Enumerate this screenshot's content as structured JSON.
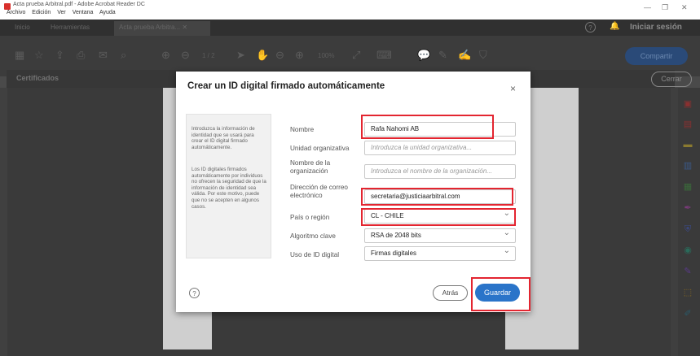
{
  "window": {
    "title": "Acta prueba Arbitral.pdf - Adobe Acrobat Reader DC",
    "menu": [
      "Archivo",
      "Edición",
      "Ver",
      "Ventana",
      "Ayuda"
    ],
    "minimize": "—",
    "restore": "❐",
    "close": "✕"
  },
  "nav": {
    "tabs": [
      "Inicio",
      "Herramientas"
    ],
    "doc_tab": "Acta prueba Arbitra... ✕",
    "sign_in": "Iniciar sesión",
    "help": "?",
    "bell": "🔔"
  },
  "toolbar": {
    "zoom": "100%",
    "page": "1 / 2",
    "share": "Compartir"
  },
  "certificates_bar": {
    "label": "Certificados",
    "close": "Cerrar"
  },
  "dialog": {
    "title": "Crear un ID digital firmado automáticamente",
    "close": "×",
    "info_p1": "Introduzca la información de identidad que se usará para crear el ID digital firmado automáticamente.",
    "info_p2": "Los ID digitales firmados automáticamente por individuos no ofrecen la seguridad de que la información de identidad sea válida. Por este motivo, puede que no se acepten en algunos casos.",
    "fields": {
      "name_label": "Nombre",
      "name_value": "Rafa Nahomi AB",
      "org_unit_label": "Unidad organizativa",
      "org_unit_placeholder": "Introduzca la unidad organizativa...",
      "org_name_label": "Nombre de la organización",
      "org_name_placeholder": "Introduzca el nombre de la organización...",
      "email_label": "Dirección de correo electrónico",
      "email_value": "secretaria@justiciaarbitral.com",
      "country_label": "País o región",
      "country_value": "CL - CHILE",
      "algorithm_label": "Algoritmo clave",
      "algorithm_value": "RSA de 2048 bits",
      "usage_label": "Uso de ID digital",
      "usage_value": "Firmas digitales"
    },
    "help": "?",
    "back": "Atrás",
    "save": "Guardar"
  },
  "colors": {
    "accent": "#2a74c9",
    "highlight": "#e32530",
    "overlay": "#4a4a4a"
  }
}
